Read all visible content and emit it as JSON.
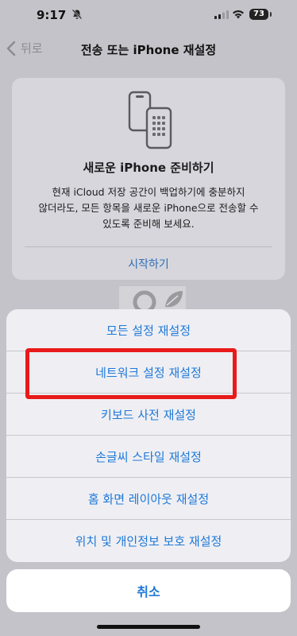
{
  "status_bar": {
    "time": "9:17",
    "battery": "73"
  },
  "nav": {
    "back_label": "뒤로",
    "title": "전송 또는 iPhone 재설정"
  },
  "card": {
    "title": "새로운 iPhone 준비하기",
    "body_lines": [
      "현재 iCloud 저장 공간이 백업하기에 충분하지",
      "않더라도, 모든 항목을 새로운 iPhone으로 전송할 수",
      "있도록 준비해 보세요."
    ],
    "link": "시작하기"
  },
  "action_sheet": {
    "items": [
      "모든 설정 재설정",
      "네트워크 설정 재설정",
      "키보드 사전 재설정",
      "손글씨 스타일 재설정",
      "홈 화면 레이아웃 재설정",
      "위치 및 개인정보 보호 재설정"
    ],
    "cancel": "취소"
  },
  "colors": {
    "accent": "#1e78d8",
    "highlight": "#e81a1a"
  }
}
